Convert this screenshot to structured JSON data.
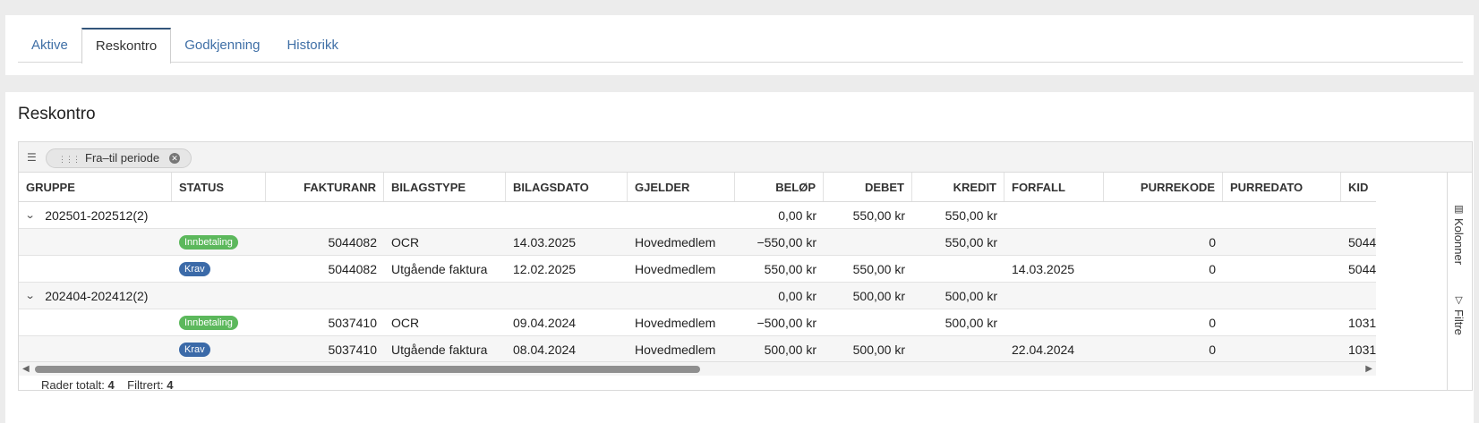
{
  "tabs": [
    {
      "label": "Aktive"
    },
    {
      "label": "Reskontro"
    },
    {
      "label": "Godkjenning"
    },
    {
      "label": "Historikk"
    }
  ],
  "page_title": "Reskontro",
  "group_chip": {
    "label": "Fra–til periode"
  },
  "columns": {
    "gruppe": "GRUPPE",
    "status": "STATUS",
    "fakturanr": "FAKTURANR",
    "bilagstype": "BILAGSTYPE",
    "bilagsdato": "BILAGSDATO",
    "gjelder": "GJELDER",
    "belop": "BELØP",
    "debet": "DEBET",
    "kredit": "KREDIT",
    "forfall": "FORFALL",
    "purrekode": "PURREKODE",
    "purredato": "PURREDATO",
    "kid": "KID"
  },
  "groups": [
    {
      "label": "202501-202512",
      "count": "(2)",
      "belop": "0,00 kr",
      "debet": "550,00 kr",
      "kredit": "550,00 kr",
      "rows": [
        {
          "status": "Innbetaling",
          "fakturanr": "5044082",
          "bilagstype": "OCR",
          "bilagsdato": "14.03.2025",
          "gjelder": "Hovedmedlem",
          "belop": "−550,00 kr",
          "debet": "",
          "kredit": "550,00 kr",
          "forfall": "",
          "purrekode": "0",
          "purredato": "",
          "kid": "5044"
        },
        {
          "status": "Krav",
          "fakturanr": "5044082",
          "bilagstype": "Utgående faktura",
          "bilagsdato": "12.02.2025",
          "gjelder": "Hovedmedlem",
          "belop": "550,00 kr",
          "debet": "550,00 kr",
          "kredit": "",
          "forfall": "14.03.2025",
          "purrekode": "0",
          "purredato": "",
          "kid": "5044"
        }
      ]
    },
    {
      "label": "202404-202412",
      "count": "(2)",
      "belop": "0,00 kr",
      "debet": "500,00 kr",
      "kredit": "500,00 kr",
      "rows": [
        {
          "status": "Innbetaling",
          "fakturanr": "5037410",
          "bilagstype": "OCR",
          "bilagsdato": "09.04.2024",
          "gjelder": "Hovedmedlem",
          "belop": "−500,00 kr",
          "debet": "",
          "kredit": "500,00 kr",
          "forfall": "",
          "purrekode": "0",
          "purredato": "",
          "kid": "1031"
        },
        {
          "status": "Krav",
          "fakturanr": "5037410",
          "bilagstype": "Utgående faktura",
          "bilagsdato": "08.04.2024",
          "gjelder": "Hovedmedlem",
          "belop": "500,00 kr",
          "debet": "500,00 kr",
          "kredit": "",
          "forfall": "22.04.2024",
          "purrekode": "0",
          "purredato": "",
          "kid": "1031"
        }
      ]
    }
  ],
  "side_tools": {
    "columns_label": "Kolonner",
    "filters_label": "Filtre"
  },
  "footer": {
    "total_label": "Rader totalt:",
    "total_value": "4",
    "filtered_label": "Filtrert:",
    "filtered_value": "4"
  },
  "colors": {
    "innbetaling": "#5cb85c",
    "krav": "#3b6aa8",
    "active_tab_border": "#33557a",
    "link": "#3f6fa6"
  }
}
